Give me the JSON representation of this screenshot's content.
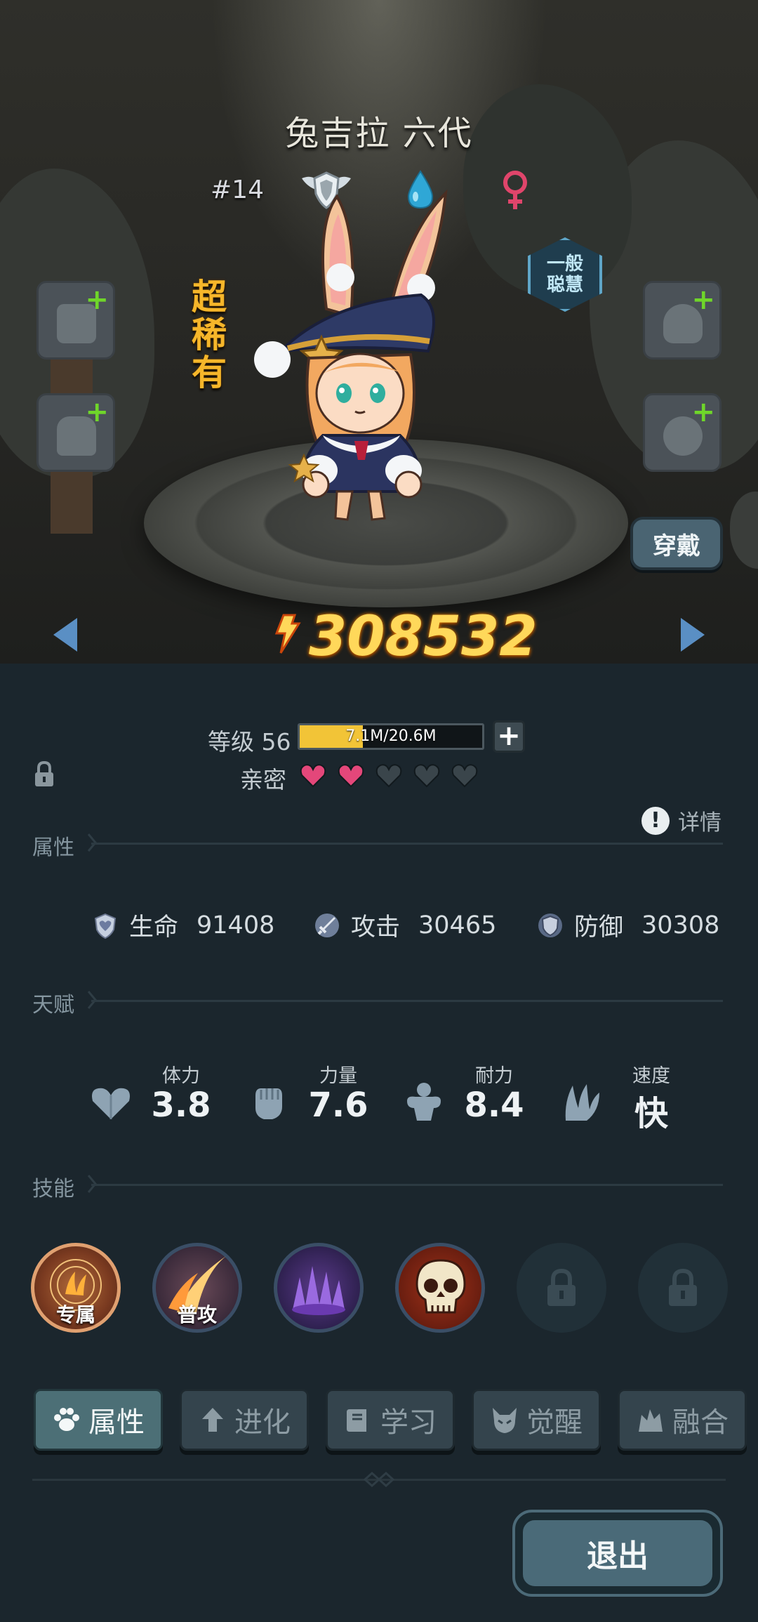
{
  "character": {
    "name": "兔吉拉 六代",
    "number": "#14",
    "rarity": "超稀有",
    "intelligence": "一般聪慧",
    "power": "308532"
  },
  "buttons": {
    "wear": "穿戴",
    "exit": "退出"
  },
  "level": {
    "label": "等级 56",
    "exp_text": "7.1M/20.6M",
    "exp_fraction": 0.345
  },
  "intimacy": {
    "label": "亲密",
    "filled": 2,
    "total": 5
  },
  "detail_label": "详情",
  "sections": {
    "attributes": "属性",
    "talents": "天赋",
    "skills": "技能"
  },
  "attributes": [
    {
      "name": "生命",
      "value": "91408",
      "icon": "heart-shield-icon"
    },
    {
      "name": "攻击",
      "value": "30465",
      "icon": "sword-icon"
    },
    {
      "name": "防御",
      "value": "30308",
      "icon": "shield-icon"
    }
  ],
  "talents": [
    {
      "name": "体力",
      "value": "3.8",
      "icon": "heart-icon"
    },
    {
      "name": "力量",
      "value": "7.6",
      "icon": "fist-icon"
    },
    {
      "name": "耐力",
      "value": "8.4",
      "icon": "muscle-icon"
    },
    {
      "name": "速度",
      "value": "快",
      "icon": "wing-icon"
    }
  ],
  "skills": [
    {
      "label": "专属",
      "icon": "rune-claw-icon"
    },
    {
      "label": "普攻",
      "icon": "slash-icon"
    },
    {
      "label": "",
      "icon": "dark-spikes-icon"
    },
    {
      "label": "",
      "icon": "skull-icon"
    },
    {
      "label": "",
      "icon": "lock-icon"
    },
    {
      "label": "",
      "icon": "lock-icon"
    }
  ],
  "tabs": [
    {
      "label": "属性",
      "icon": "paw-icon",
      "active": true
    },
    {
      "label": "进化",
      "icon": "arrow-up-icon",
      "active": false
    },
    {
      "label": "学习",
      "icon": "book-icon",
      "active": false
    },
    {
      "label": "觉醒",
      "icon": "demon-icon",
      "active": false
    },
    {
      "label": "融合",
      "icon": "merge-icon",
      "active": false
    }
  ],
  "colors": {
    "accent_gold": "#f6b62a",
    "power_gold": "#ffd85a",
    "heart_filled": "#e4477a",
    "heart_empty": "#3a454b",
    "exp_fill": "#f2c437",
    "plus_green": "#6fd62a"
  }
}
